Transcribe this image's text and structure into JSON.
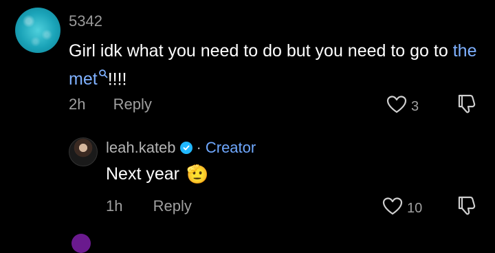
{
  "comment": {
    "username": "5342",
    "text_before": "Girl idk what you need to do but you need to go to ",
    "link_text": "the met",
    "text_after": "!!!!",
    "time": "2h",
    "reply_label": "Reply",
    "like_count": "3"
  },
  "reply": {
    "username": "leah.kateb",
    "separator": "·",
    "role": "Creator",
    "text": "Next year",
    "emoji": "🫡",
    "time": "1h",
    "reply_label": "Reply",
    "like_count": "10"
  },
  "icons": {
    "like": "heart-outline-icon",
    "dislike": "thumbs-down-icon",
    "verified": "verified-check-icon",
    "search": "search-icon"
  },
  "colors": {
    "background": "#000000",
    "link": "#7fb1ff",
    "creator": "#6fa8ff",
    "verified": "#21b8ff"
  }
}
